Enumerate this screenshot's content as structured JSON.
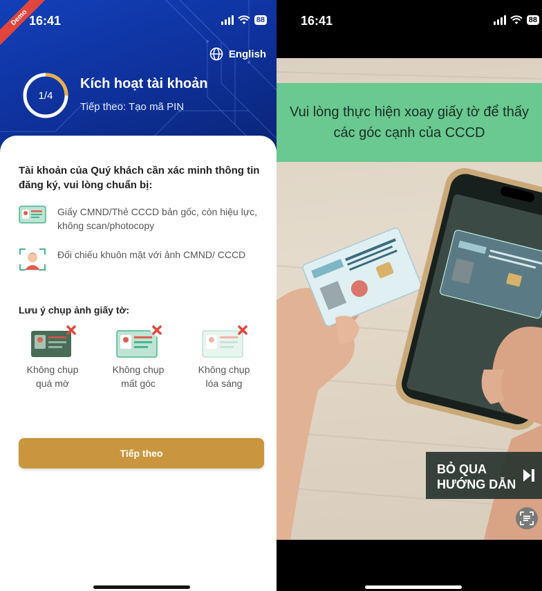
{
  "left_screen": {
    "status": {
      "time": "16:41",
      "battery": "88",
      "demo_badge": "Demo"
    },
    "language_button": "English",
    "progress": {
      "label": "1/4",
      "fraction": 0.25
    },
    "title": "Kích hoạt tài khoản",
    "subtitle": "Tiếp theo: Tạo mã PIN",
    "intro": "Tài khoản của Quý khách cần xác minh thông tin đăng ký, vui lòng chuẩn bị:",
    "requirements": [
      {
        "icon": "id-card-icon",
        "text": "Giấy CMND/Thẻ CCCD bản gốc, còn hiệu lực, không scan/photocopy"
      },
      {
        "icon": "face-scan-icon",
        "text": "Đối chiếu khuôn mặt với ảnh CMND/ CCCD"
      }
    ],
    "note_title": "Lưu ý chụp ảnh giấy tờ:",
    "tips": [
      {
        "icon": "blurry-card-icon",
        "line1": "Không chụp",
        "line2": "quá mờ"
      },
      {
        "icon": "cropped-card-icon",
        "line1": "Không chụp",
        "line2": "mất góc"
      },
      {
        "icon": "glare-card-icon",
        "line1": "Không chụp",
        "line2": "lóa sáng"
      }
    ],
    "next_button": "Tiếp theo",
    "colors": {
      "accent": "#c9963f",
      "hero": "#1340b8",
      "error": "#e0463d"
    }
  },
  "right_screen": {
    "status": {
      "time": "16:41",
      "battery": "88"
    },
    "banner_text": "Vui lòng thực hiện xoay giấy tờ để thấy các góc cạnh của CCCD",
    "skip_button": {
      "line1": "BỎ QUA",
      "line2": "HƯỚNG DẪN"
    },
    "scan_button_icon": "scan-text-icon",
    "colors": {
      "banner": "#69c990",
      "skip_bg": "#283430"
    }
  }
}
